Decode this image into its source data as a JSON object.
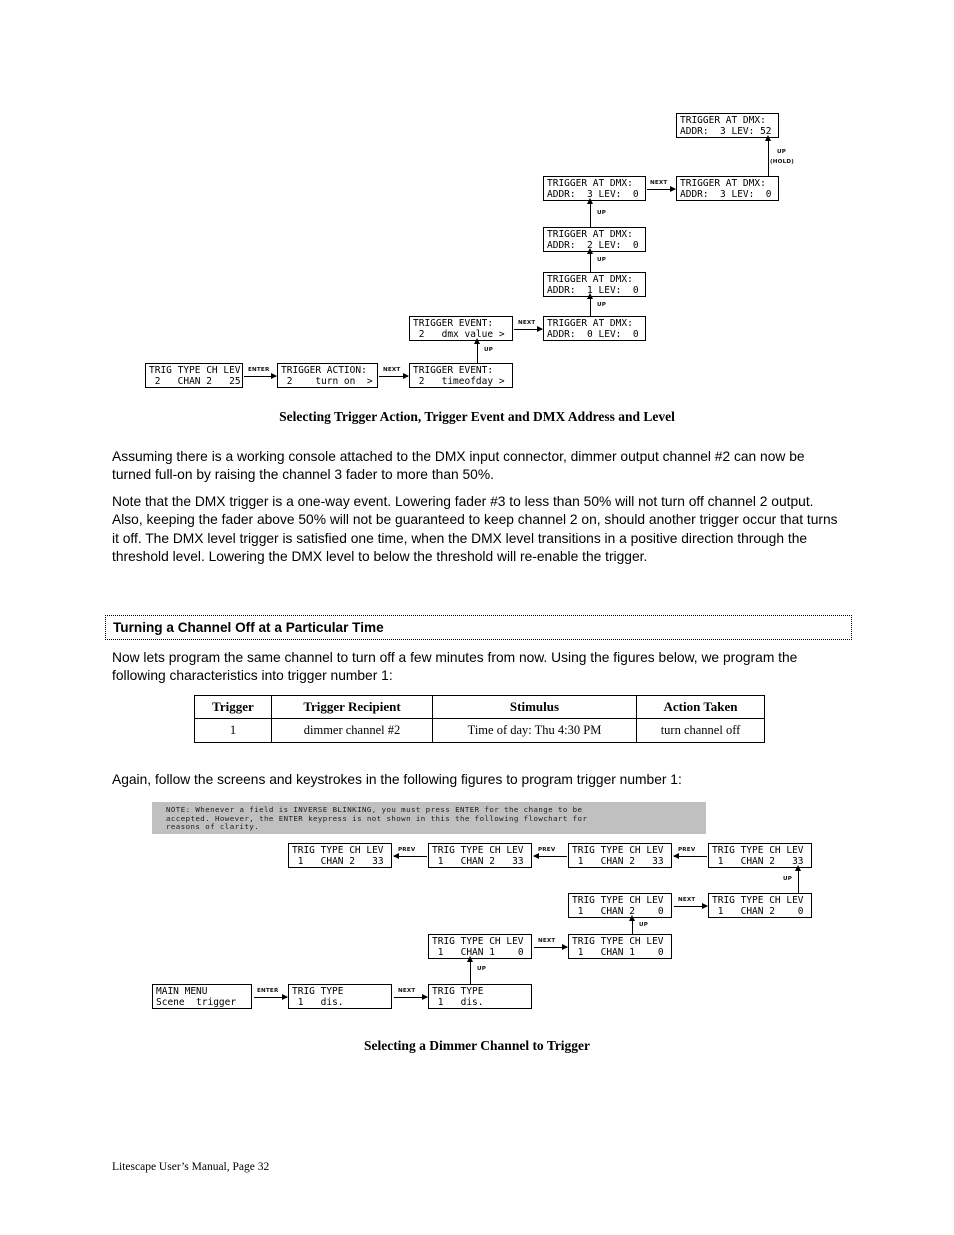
{
  "keys": {
    "up": "UP",
    "hold": "(HOLD)",
    "next": "NEXT",
    "enter": "ENTER",
    "prev": "PREV"
  },
  "diagram1": {
    "caption": "Selecting Trigger Action, Trigger Event and DMX Address and Level",
    "boxes": [
      {
        "name": "dmx-addr3-lev52",
        "line1": "TRIGGER AT DMX:",
        "pre": "ADDR:  3 LEV: ",
        "hl": "52",
        "post": ""
      },
      {
        "name": "dmx-addr3-lev0-edit",
        "line1": "TRIGGER AT DMX:",
        "pre": "ADDR:  3 LEV:  ",
        "hl": "0",
        "post": ""
      },
      {
        "name": "dmx-addr3",
        "line1": "TRIGGER AT DMX:",
        "pre": "ADDR:  ",
        "hl": "3",
        "post": " LEV:  0"
      },
      {
        "name": "dmx-addr2",
        "line1": "TRIGGER AT DMX:",
        "pre": "ADDR:  ",
        "hl": "2",
        "post": " LEV:  0"
      },
      {
        "name": "dmx-addr1",
        "line1": "TRIGGER AT DMX:",
        "pre": "ADDR:  ",
        "hl": "1",
        "post": " LEV:  0"
      },
      {
        "name": "dmx-addr0",
        "line1": "TRIGGER AT DMX:",
        "pre": "ADDR:  ",
        "hl": "0",
        "post": " LEV:  0"
      },
      {
        "name": "trigger-event-dmx-value",
        "line1": "TRIGGER EVENT:",
        "pre": " 2   ",
        "hl": "dmx value",
        "post": " >"
      },
      {
        "name": "trig-type-ch-lev",
        "line1": "TRIG TYPE CH LEV",
        "pre": " ",
        "hl": "2",
        "post": "   CHAN 2   25"
      },
      {
        "name": "trigger-action-turn-on",
        "line1": "TRIGGER ACTION:",
        "pre": " 2    ",
        "hl": "turn on",
        "post": "  >"
      },
      {
        "name": "trigger-event-timeofday",
        "line1": "TRIGGER EVENT:",
        "pre": " 2   ",
        "hl": "timeofday",
        "post": " >"
      }
    ]
  },
  "body": {
    "para1": "Assuming there is a working console attached to the DMX input connector, dimmer output channel #2 can now be turned full-on by raising the channel 3 fader to more than 50%.",
    "para2": "Note that the DMX trigger is a one-way event. Lowering fader #3 to less than 50% will not turn off channel 2 output. Also, keeping the fader above 50% will not be guaranteed to keep channel 2 on, should another trigger occur that turns it off. The DMX level trigger is satisfied one time, when the DMX level transitions in a positive direction through the threshold level. Lowering the DMX level to below the threshold will re-enable the trigger.",
    "section_title": "Turning a Channel Off at a Particular Time",
    "para3": "Now lets program the same channel to turn off a few minutes from now. Using the figures below, we program the following characteristics into trigger number 1:",
    "para4": "Again, follow the screens and keystrokes in the following figures to program trigger number 1:"
  },
  "table": {
    "headers": [
      "Trigger",
      "Trigger Recipient",
      "Stimulus",
      "Action Taken"
    ],
    "rows": [
      [
        "1",
        "dimmer channel #2",
        "Time of day: Thu 4:30 PM",
        "turn channel off"
      ]
    ]
  },
  "note": {
    "line1": "NOTE: Whenever a field is INVERSE BLINKING, you must press ENTER for the change to be",
    "line2": "accepted. However, the ENTER keypress is not shown in this the following flowchart for",
    "line3": "reasons of clarity."
  },
  "diagram2": {
    "caption": "Selecting a Dimmer Channel to Trigger",
    "boxes": [
      {
        "name": "trig-1-trignum-sel",
        "line1": "TRIG TYPE CH LEV",
        "pre": " ",
        "hl": "1",
        "post": "   CHAN 2   33"
      },
      {
        "name": "trig-1-type-sel",
        "line1": "TRIG TYPE CH LEV",
        "pre": " 1   ",
        "hl": "CHAN",
        "post": " 2   33"
      },
      {
        "name": "trig-1-ch-sel-33",
        "line1": "TRIG TYPE CH LEV",
        "pre": " 1   CHAN ",
        "hl": "2",
        "post": "   33"
      },
      {
        "name": "trig-1-lev-33",
        "line1": "TRIG TYPE CH LEV",
        "pre": " 1   CHAN 2   ",
        "hl": "33",
        "post": ""
      },
      {
        "name": "trig-1-ch2-lev0",
        "line1": "TRIG TYPE CH LEV",
        "pre": " 1   CHAN ",
        "hl": "2",
        "post": "    0"
      },
      {
        "name": "trig-1-lev0-sel",
        "line1": "TRIG TYPE CH LEV",
        "pre": " 1   CHAN 2    ",
        "hl": "0",
        "post": ""
      },
      {
        "name": "trig-1-chan-sel",
        "line1": "TRIG TYPE CH LEV",
        "pre": " 1   ",
        "hl": "CHAN",
        "post": " 1    0"
      },
      {
        "name": "trig-1-ch1-sel",
        "line1": "TRIG TYPE CH LEV",
        "pre": " 1   CHAN ",
        "hl": "1",
        "post": "    0"
      },
      {
        "name": "main-menu",
        "line1": "MAIN MENU",
        "pre": "Scene  ",
        "hl": "trigger",
        "post": ""
      },
      {
        "name": "trig-type-num-sel",
        "line1": "TRIG TYPE",
        "pre": " ",
        "hl": "1",
        "post": "   dis."
      },
      {
        "name": "trig-type-dis-sel",
        "line1": "TRIG TYPE",
        "pre": " 1   ",
        "hl": "dis.",
        "post": ""
      }
    ]
  },
  "footer": "Litescape User’s Manual, Page 32"
}
